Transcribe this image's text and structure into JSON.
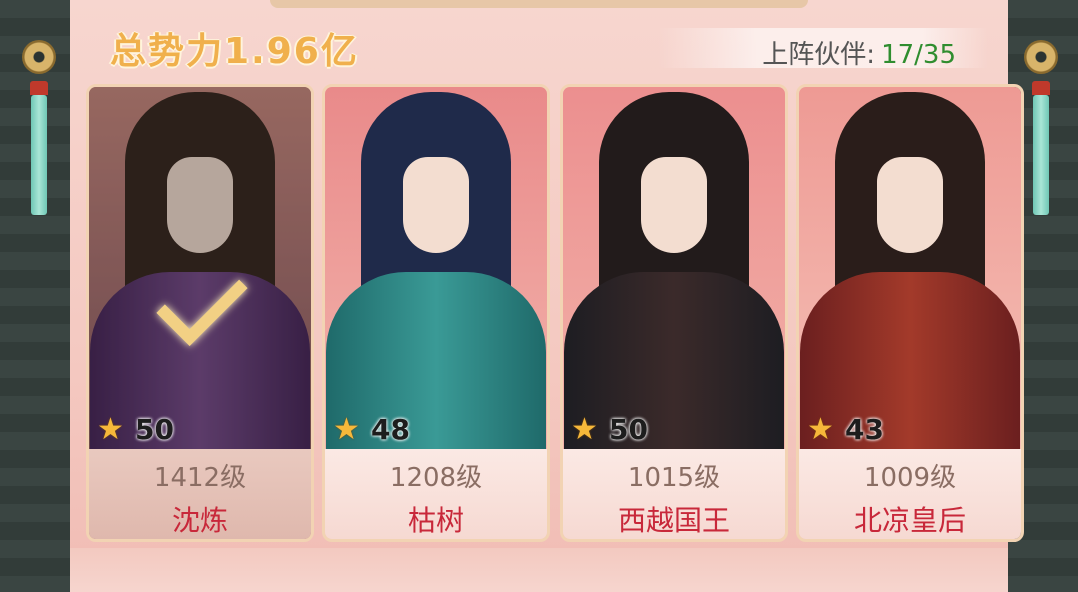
{
  "header": {
    "total_power": "总势力1.96亿",
    "partners_label": "上阵伙伴:",
    "partners_count": "17/35"
  },
  "cards": [
    {
      "stars": "50",
      "level": "1412级",
      "name": "沈炼",
      "selected": true
    },
    {
      "stars": "48",
      "level": "1208级",
      "name": "枯树",
      "selected": false
    },
    {
      "stars": "50",
      "level": "1015级",
      "name": "西越国王",
      "selected": false
    },
    {
      "stars": "43",
      "level": "1009级",
      "name": "北凉皇后",
      "selected": false
    }
  ],
  "icons": {
    "star": "star-icon",
    "check": "checkmark-icon"
  }
}
